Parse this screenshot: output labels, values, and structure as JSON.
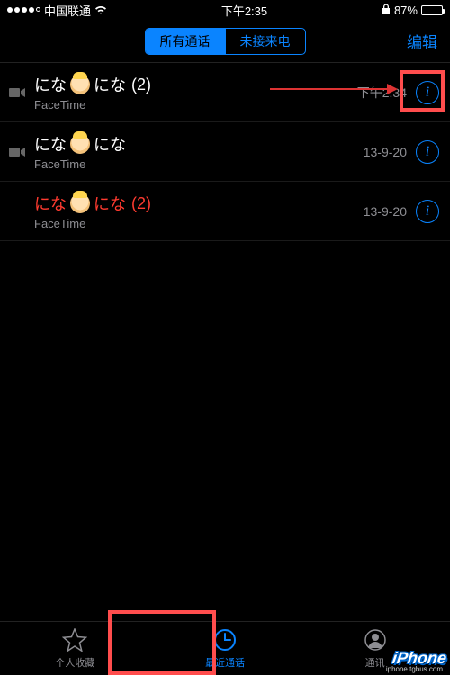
{
  "status": {
    "carrier": "中国联通",
    "time": "下午2:35",
    "battery_pct": "87%"
  },
  "nav": {
    "segment_all": "所有通话",
    "segment_missed": "未接来电",
    "edit": "编辑"
  },
  "calls": [
    {
      "name_pre": "にな",
      "name_post": "にな",
      "count": "(2)",
      "sub": "FaceTime",
      "time": "下午2:34",
      "missed": false
    },
    {
      "name_pre": "にな",
      "name_post": "にな",
      "count": "",
      "sub": "FaceTime",
      "time": "13-9-20",
      "missed": false
    },
    {
      "name_pre": "にな",
      "name_post": "にな",
      "count": "(2)",
      "sub": "FaceTime",
      "time": "13-9-20",
      "missed": true
    }
  ],
  "tabs": {
    "favorites": "个人收藏",
    "recents": "最近通话",
    "contacts": "通讯"
  },
  "watermark": {
    "main": "iPhone",
    "sub": "iphone.tgbus.com"
  },
  "info_glyph": "i"
}
